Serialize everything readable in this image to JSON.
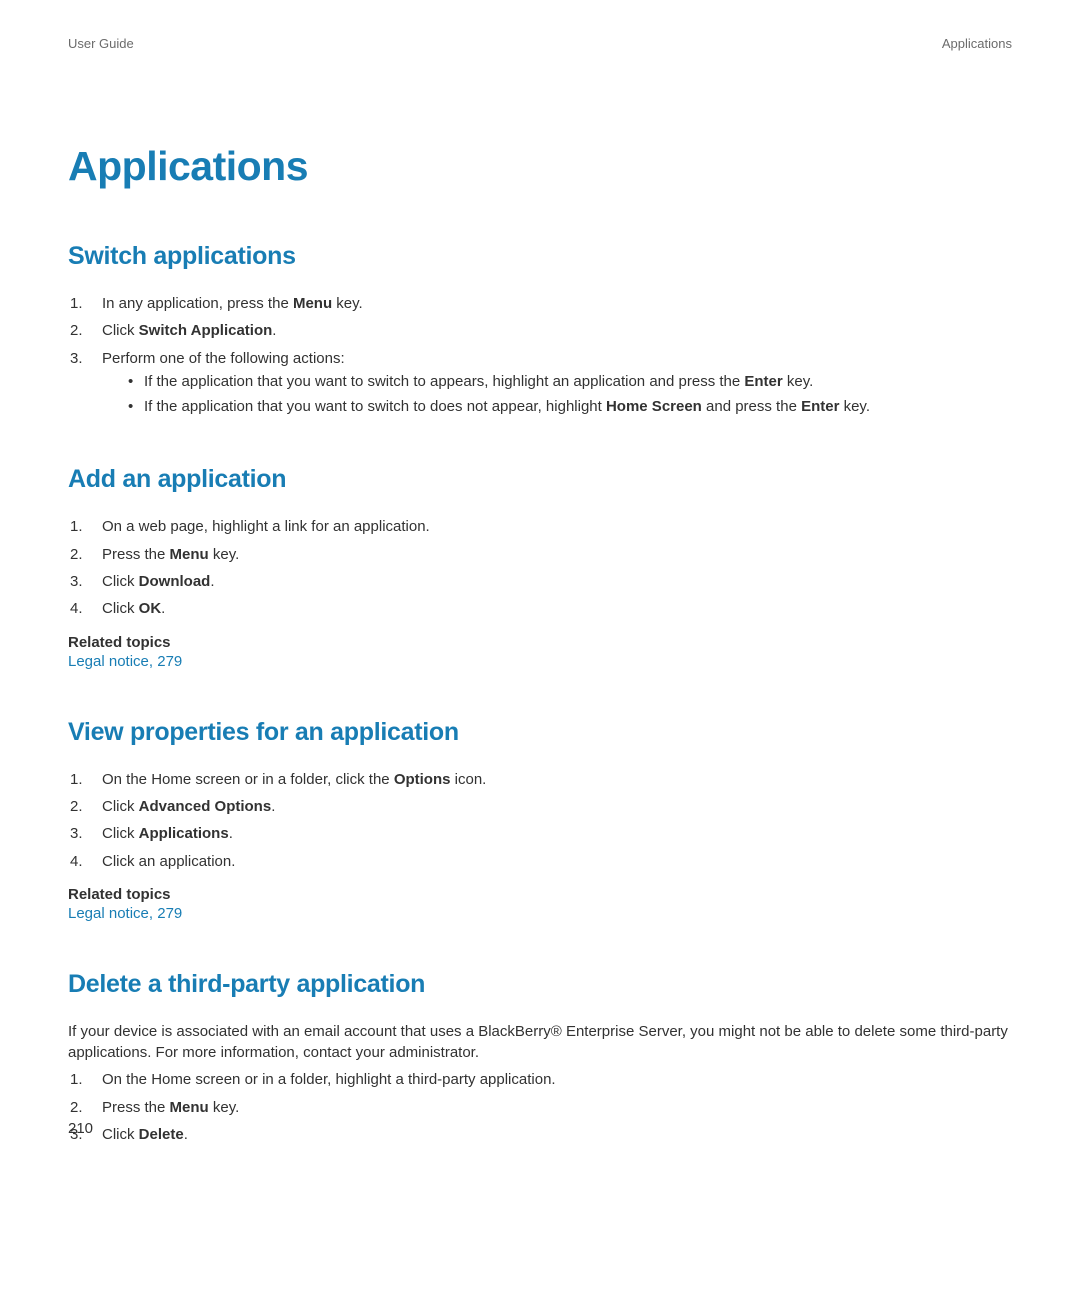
{
  "header": {
    "left": "User Guide",
    "right": "Applications"
  },
  "title": "Applications",
  "sections": {
    "switch": {
      "heading": "Switch applications",
      "steps": {
        "s1a": "In any application, press the ",
        "s1b": "Menu",
        "s1c": " key.",
        "s2a": "Click ",
        "s2b": "Switch Application",
        "s2c": ".",
        "s3a": "Perform one of the following actions:",
        "b1a": "If the application that you want to switch to appears, highlight an application and press the ",
        "b1b": "Enter",
        "b1c": " key.",
        "b2a": "If the application that you want to switch to does not appear, highlight ",
        "b2b": "Home Screen",
        "b2c": " and press the ",
        "b2d": "Enter",
        "b2e": " key."
      }
    },
    "add": {
      "heading": "Add an application",
      "steps": {
        "s1": "On a web page, highlight a link for an application.",
        "s2a": "Press the ",
        "s2b": "Menu",
        "s2c": " key.",
        "s3a": "Click ",
        "s3b": "Download",
        "s3c": ".",
        "s4a": "Click ",
        "s4b": "OK",
        "s4c": "."
      },
      "related_label": "Related topics",
      "related_link": "Legal notice, 279"
    },
    "view": {
      "heading": "View properties for an application",
      "steps": {
        "s1a": "On the Home screen or in a folder, click the ",
        "s1b": "Options",
        "s1c": " icon.",
        "s2a": "Click ",
        "s2b": "Advanced Options",
        "s2c": ".",
        "s3a": "Click ",
        "s3b": "Applications",
        "s3c": ".",
        "s4": "Click an application."
      },
      "related_label": "Related topics",
      "related_link": "Legal notice, 279"
    },
    "delete": {
      "heading": "Delete a third-party application",
      "intro": "If your device is associated with an email account that uses a BlackBerry® Enterprise Server, you might not be able to delete some third-party applications. For more information, contact your administrator.",
      "steps": {
        "s1": "On the Home screen or in a folder, highlight a third-party application.",
        "s2a": "Press the ",
        "s2b": "Menu",
        "s2c": " key.",
        "s3a": "Click ",
        "s3b": "Delete",
        "s3c": "."
      }
    }
  },
  "page_number": "210"
}
